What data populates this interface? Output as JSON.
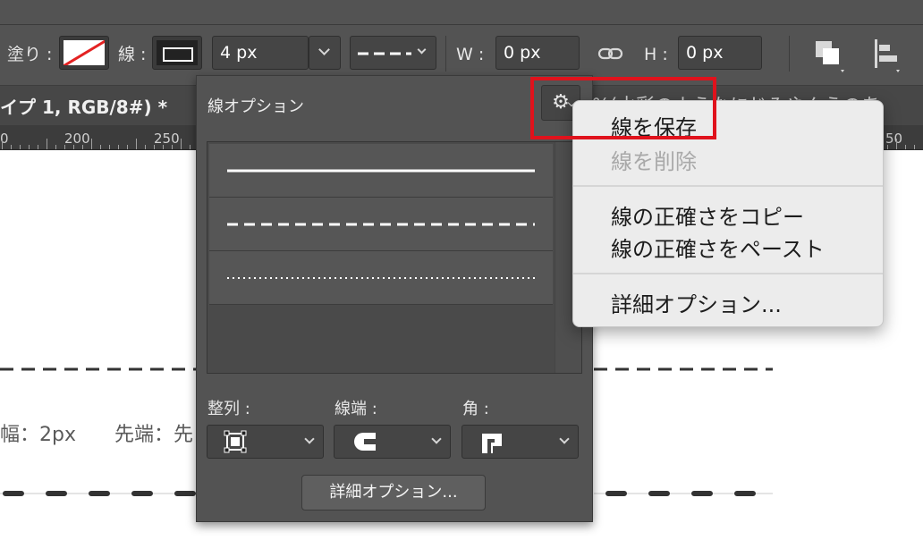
{
  "options_bar": {
    "fill_label": "塗り :",
    "stroke_label": "線 :",
    "stroke_width": "4 px",
    "w_label": "W :",
    "w_value": "0 px",
    "h_label": "H :",
    "h_value": "0 px"
  },
  "document": {
    "title": "イプ 1, RGB/8#) *",
    "right_text": "%(水彩のようなにじみやんうのあ"
  },
  "ruler": {
    "labels": [
      "0",
      "200",
      "250",
      "50"
    ]
  },
  "canvas": {
    "text_width": "幅：2px",
    "text_cap": "先端：先"
  },
  "stroke_panel": {
    "title": "線オプション",
    "align_label": "整列 :",
    "cap_label": "線端 :",
    "corner_label": "角 :",
    "more_button": "詳細オプション..."
  },
  "menu": {
    "save": "線を保存",
    "delete": "線を削除",
    "copy": "線の正確さをコピー",
    "paste": "線の正確さをペースト",
    "more": "詳細オプション..."
  },
  "colors": {
    "highlight": "#e0121c",
    "panel_bg": "#535353",
    "menu_bg": "#ececec"
  }
}
